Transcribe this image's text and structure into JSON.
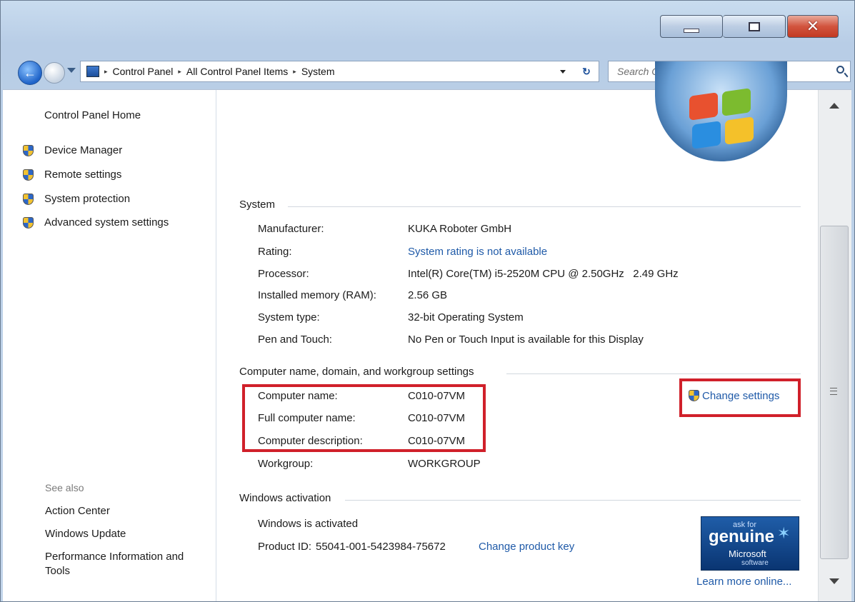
{
  "titlebar": {
    "buttons": {
      "minimize": "minimize-icon",
      "maximize": "maximize-icon",
      "close": "close-icon"
    },
    "close_glyph": "✕"
  },
  "addressbar": {
    "back_glyph": "←",
    "breadcrumbs": [
      "Control Panel",
      "All Control Panel Items",
      "System"
    ],
    "separator": "▸",
    "refresh_glyph": "↻"
  },
  "search": {
    "placeholder": "Search Control Panel"
  },
  "sidebar": {
    "home": "Control Panel Home",
    "tasks": [
      "Device Manager",
      "Remote settings",
      "System protection",
      "Advanced system settings"
    ],
    "see_also_title": "See also",
    "see_also": [
      "Action Center",
      "Windows Update",
      "Performance Information and",
      "Tools"
    ]
  },
  "system": {
    "title": "System",
    "rows": [
      {
        "label": "Manufacturer:",
        "value": "KUKA Roboter GmbH"
      },
      {
        "label": "Rating:",
        "value": "System rating is not available"
      },
      {
        "label": "Processor:",
        "value": "Intel(R) Core(TM) i5-2520M CPU @ 2.50GHz   2.49 GHz"
      },
      {
        "label": "Installed memory (RAM):",
        "value": "2.56 GB"
      },
      {
        "label": "System type:",
        "value": "32-bit Operating System"
      },
      {
        "label": "Pen and Touch:",
        "value": "No Pen or Touch Input is available for this Display"
      }
    ]
  },
  "computer": {
    "title": "Computer name, domain, and workgroup settings",
    "change_settings": "Change settings",
    "rows": [
      {
        "label": "Computer name:",
        "value": "C010-07VM"
      },
      {
        "label": "Full computer name:",
        "value": "C010-07VM"
      },
      {
        "label": "Computer description:",
        "value": "C010-07VM"
      },
      {
        "label": "Workgroup:",
        "value": "WORKGROUP"
      }
    ]
  },
  "activation": {
    "title": "Windows activation",
    "status": "Windows is activated",
    "product_id_label": "Product ID:",
    "product_id": "55041-001-5423984-75672",
    "change_key": "Change product key",
    "learn_more": "Learn more online...",
    "badge": {
      "ask": "ask for",
      "big": "genuine",
      "ms": "Microsoft",
      "sw": "software"
    }
  },
  "colors": {
    "link": "#1f5aa8",
    "highlight": "#d0202a"
  }
}
